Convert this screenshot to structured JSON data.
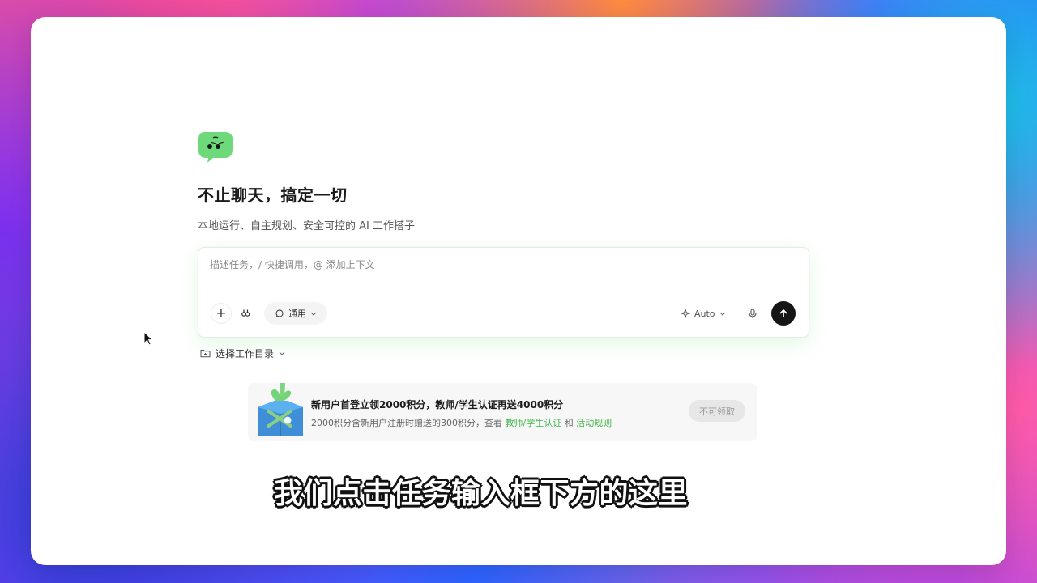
{
  "hero": {
    "title": "不止聊天，搞定一切",
    "subtitle": "本地运行、自主规划、安全可控的 AI 工作搭子"
  },
  "task_box": {
    "placeholder": "描述任务，/ 快捷调用，@ 添加上下文",
    "mode_label": "通用",
    "auto_label": "Auto"
  },
  "workspace": {
    "label": "选择工作目录"
  },
  "promo": {
    "title": "新用户首登立领2000积分，教师/学生认证再送4000积分",
    "desc_prefix": "2000积分含新用户注册时赠送的300积分，查看",
    "link_teacher": "教师/学生认证",
    "joiner": "和",
    "link_rules": "活动规则",
    "button": "不可领取"
  },
  "caption": {
    "text": "我们点击任务输入框下方的这里"
  },
  "colors": {
    "accent_green": "#43b54d",
    "send_button": "#161616",
    "promo_bg": "#f7f7f7"
  },
  "icons": {
    "logo": "green-chat-mascot",
    "add": "plus-icon",
    "agent": "agent-icon",
    "mode": "chat-bubble-icon",
    "auto": "sparkle-icon",
    "mic": "microphone-icon",
    "send": "arrow-up-icon",
    "folder": "folder-icon"
  }
}
